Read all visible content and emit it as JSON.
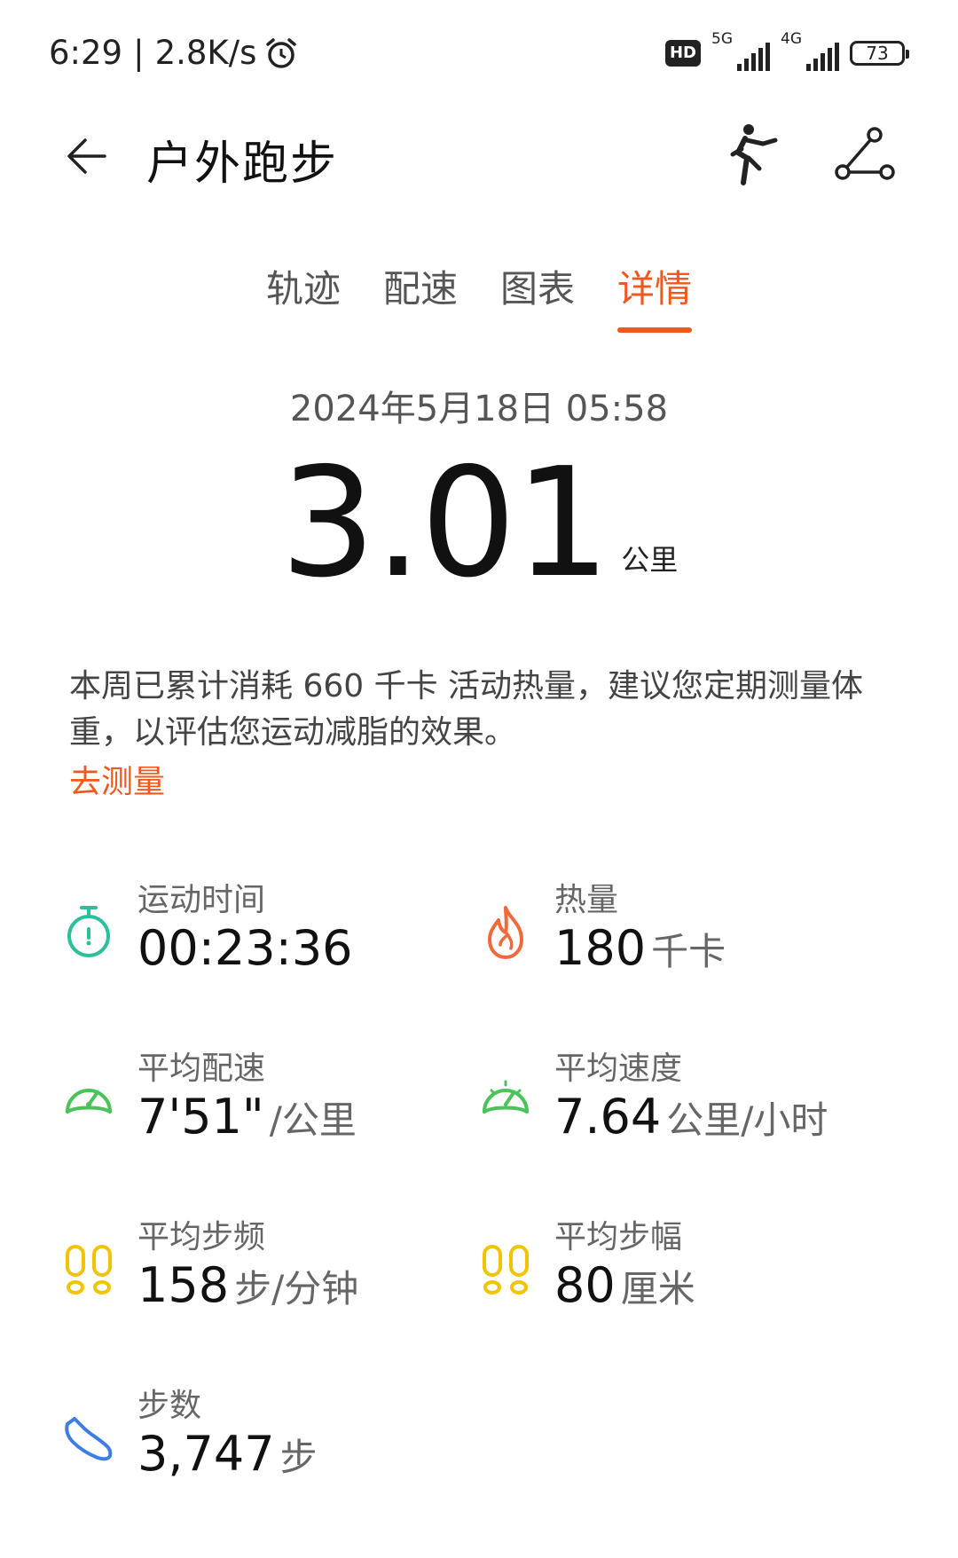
{
  "status_bar": {
    "time": "6:29",
    "speed": "2.8K/s",
    "hd": "HD",
    "net1": "5G",
    "net2": "4G",
    "battery": "73"
  },
  "header": {
    "title": "户外跑步"
  },
  "tabs": [
    {
      "label": "轨迹"
    },
    {
      "label": "配速"
    },
    {
      "label": "图表"
    },
    {
      "label": "详情"
    }
  ],
  "active_tab": "详情",
  "summary": {
    "date": "2024年5月18日 05:58",
    "distance": "3.01",
    "distance_unit": "公里"
  },
  "tip": {
    "text": "本周已累计消耗 660 千卡 活动热量，建议您定期测量体重，以评估您运动减脂的效果。",
    "link": "去测量"
  },
  "metrics": {
    "duration": {
      "label": "运动时间",
      "value": "00:23:36",
      "unit": ""
    },
    "calories": {
      "label": "热量",
      "value": "180",
      "unit": "千卡"
    },
    "avg_pace": {
      "label": "平均配速",
      "value": "7'51\"",
      "unit": "/公里"
    },
    "avg_speed": {
      "label": "平均速度",
      "value": "7.64",
      "unit": "公里/小时"
    },
    "cadence": {
      "label": "平均步频",
      "value": "158",
      "unit": "步/分钟"
    },
    "stride": {
      "label": "平均步幅",
      "value": "80",
      "unit": "厘米"
    },
    "steps": {
      "label": "步数",
      "value": "3,747",
      "unit": "步"
    }
  },
  "colors": {
    "accent": "#f0581f",
    "teal": "#2bbf9e",
    "green": "#4cc25a",
    "yellow": "#f2c300",
    "blue": "#3d7fe0",
    "flame": "#ef6a3a"
  }
}
